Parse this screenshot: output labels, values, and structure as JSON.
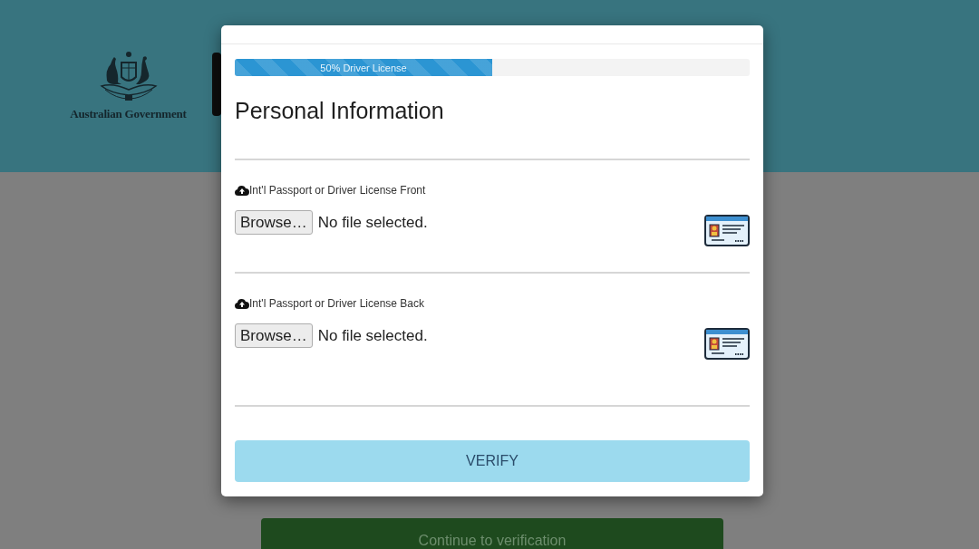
{
  "header": {
    "logo_text": "Australian Government"
  },
  "modal": {
    "progress": {
      "label": "50% Driver License",
      "level": 0.5
    },
    "title": "Personal Information",
    "uploads": [
      {
        "label": "Int'l Passport or Driver License Front",
        "button": "Browse…",
        "status": "No file selected."
      },
      {
        "label": "Int'l Passport or Driver License Back",
        "button": "Browse…",
        "status": "No file selected."
      }
    ],
    "submit": "VERIFY"
  },
  "page": {
    "continue_button": "Continue to verification"
  }
}
